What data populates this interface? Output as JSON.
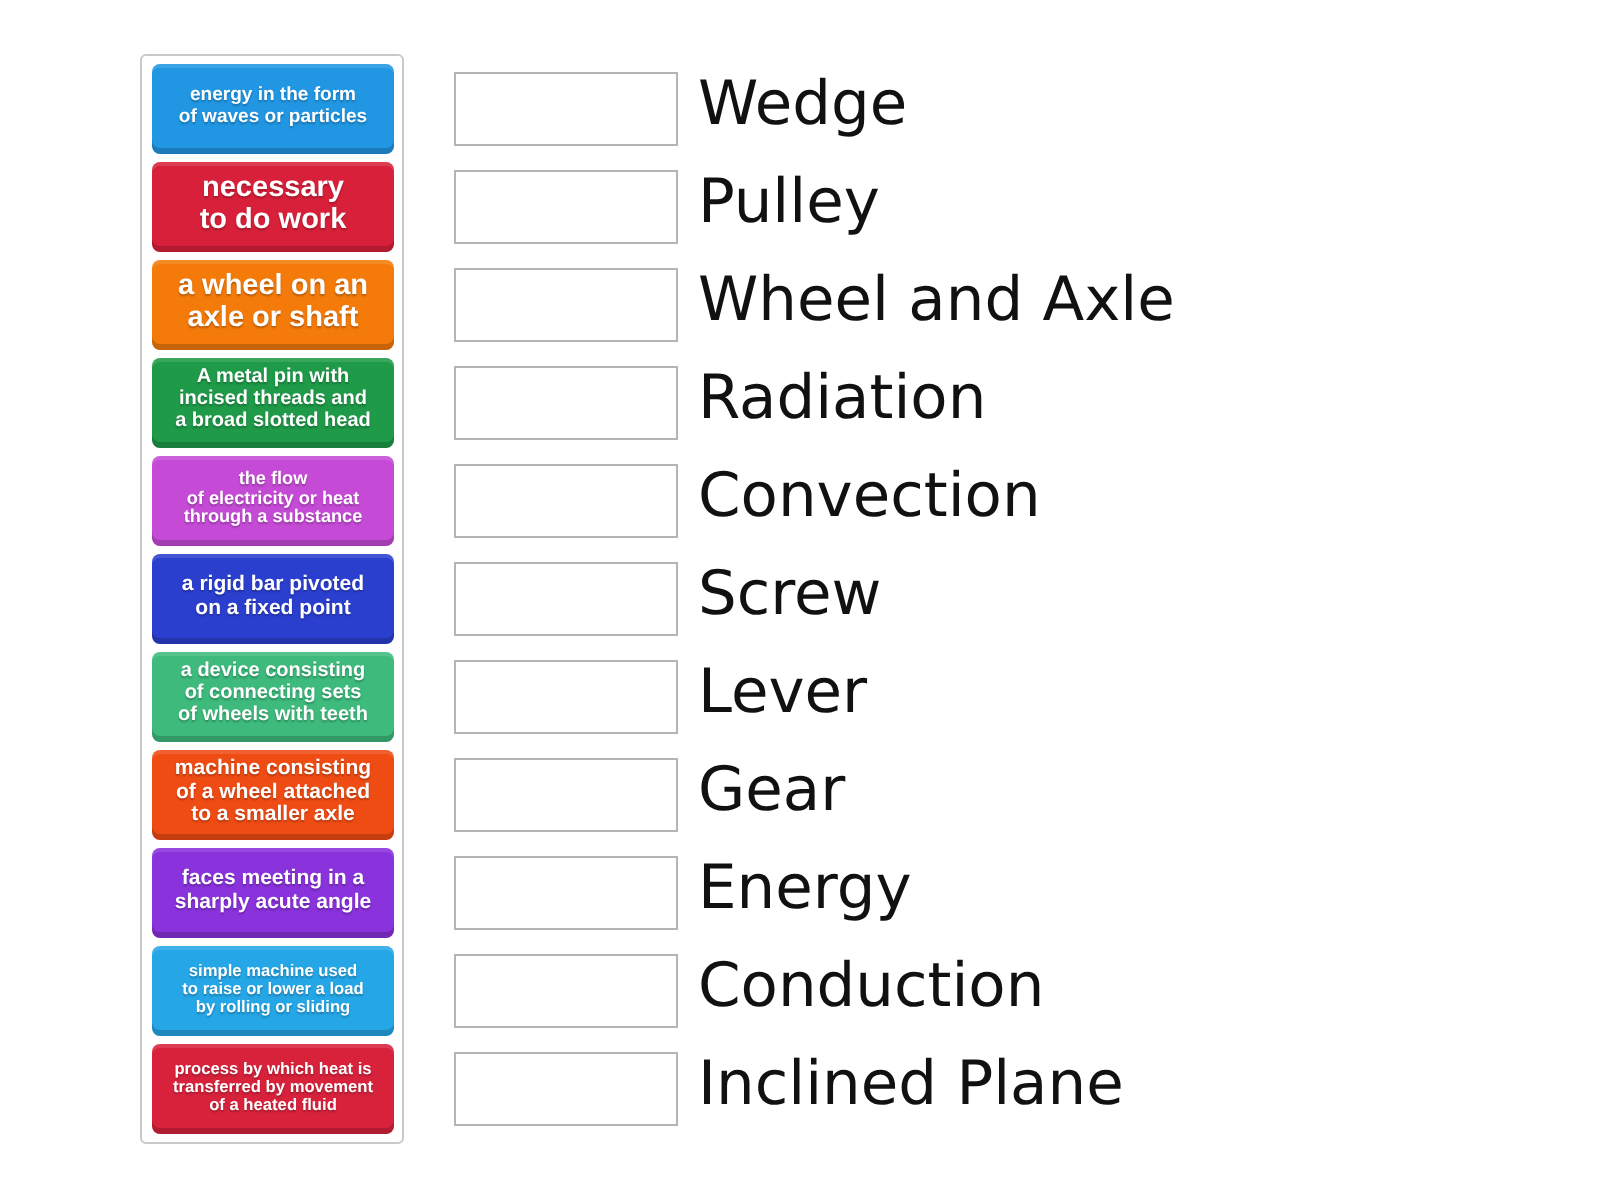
{
  "tiles": [
    {
      "text": "energy in the form\nof waves or particles",
      "color": "#2196e3"
    },
    {
      "text": "necessary\nto do work",
      "color": "#d8203a"
    },
    {
      "text": "a wheel on an\naxle or shaft",
      "color": "#f47b0a"
    },
    {
      "text": "A metal pin with\nincised threads and\na broad slotted head",
      "color": "#1e9a48"
    },
    {
      "text": "the flow\nof electricity or heat\nthrough a substance",
      "color": "#c54bd6"
    },
    {
      "text": "a rigid bar pivoted\non a fixed point",
      "color": "#2b3fcf"
    },
    {
      "text": "a device consisting\nof connecting sets\nof wheels with teeth",
      "color": "#3dba7c"
    },
    {
      "text": "machine consisting\nof a wheel attached\nto a smaller axle",
      "color": "#ef4c14"
    },
    {
      "text": "faces meeting in a\nsharply acute angle",
      "color": "#8a32dc"
    },
    {
      "text": "simple machine used\nto raise or lower a load\nby rolling or sliding",
      "color": "#25a6e6"
    },
    {
      "text": "process by which heat is\ntransferred by movement\nof a heated fluid",
      "color": "#d8223c"
    }
  ],
  "targets": [
    {
      "word": "Wedge"
    },
    {
      "word": "Pulley"
    },
    {
      "word": "Wheel and Axle"
    },
    {
      "word": "Radiation"
    },
    {
      "word": "Convection"
    },
    {
      "word": "Screw"
    },
    {
      "word": "Lever"
    },
    {
      "word": "Gear"
    },
    {
      "word": "Energy"
    },
    {
      "word": "Conduction"
    },
    {
      "word": "Inclined Plane"
    }
  ]
}
